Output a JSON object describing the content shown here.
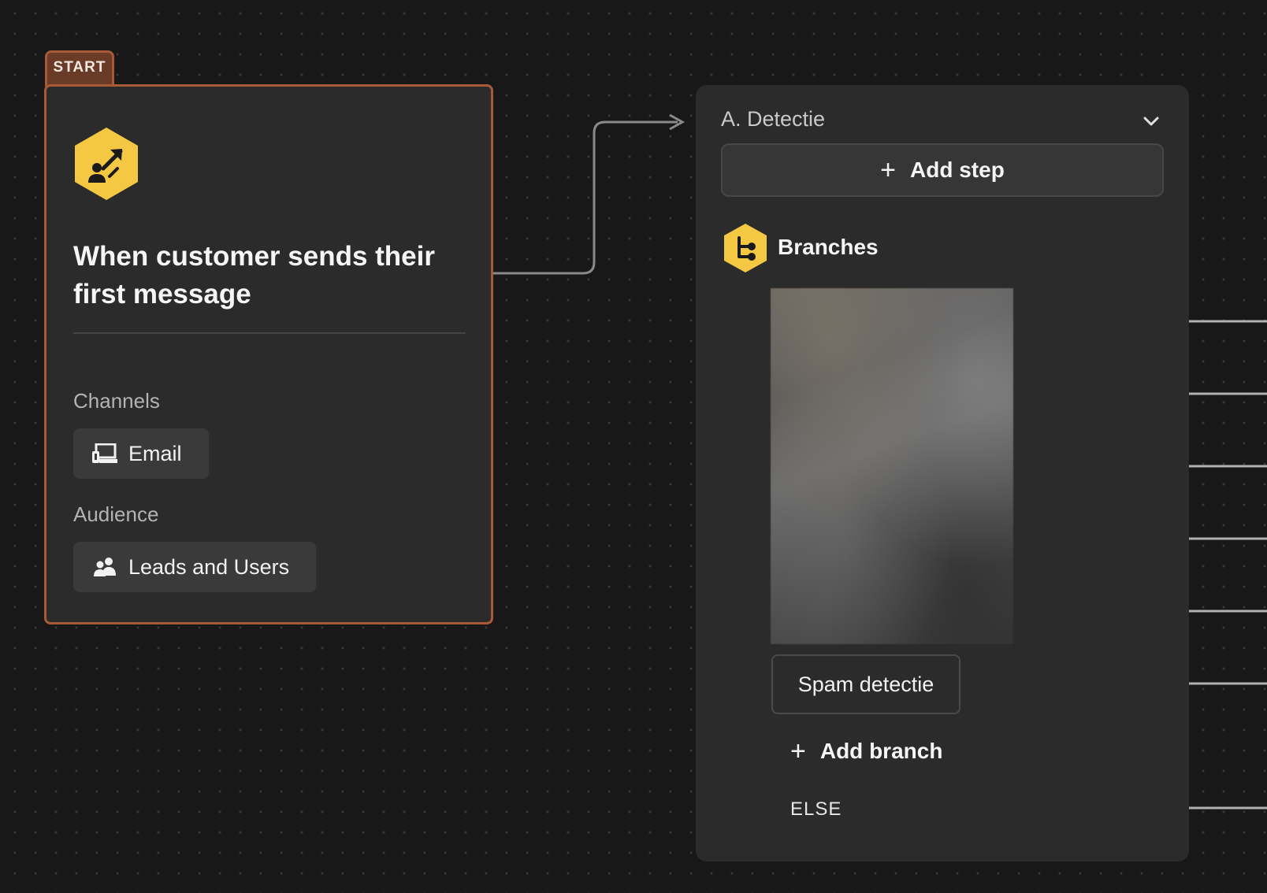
{
  "colors": {
    "canvas": "#181818",
    "card": "#2b2b2b",
    "start_accent": "#a85a36",
    "icon_yellow": "#f5c843",
    "line": "#b0b0b0"
  },
  "start_node": {
    "tab_label": "START",
    "icon": "megaphone-person-icon",
    "title": "When customer sends their first message",
    "channels_label": "Channels",
    "channel_chip": {
      "icon": "email-channel-icon",
      "label": "Email"
    },
    "audience_label": "Audience",
    "audience_chip": {
      "icon": "users-icon",
      "label": "Leads and Users"
    }
  },
  "detection_node": {
    "title": "A. Detectie",
    "chevron_icon": "chevron-down-icon",
    "add_step_label": "Add step",
    "branches_icon": "branches-icon",
    "branches_label": "Branches",
    "spam_branch_label": "Spam detectie",
    "add_branch_label": "Add branch",
    "else_label": "ELSE"
  }
}
